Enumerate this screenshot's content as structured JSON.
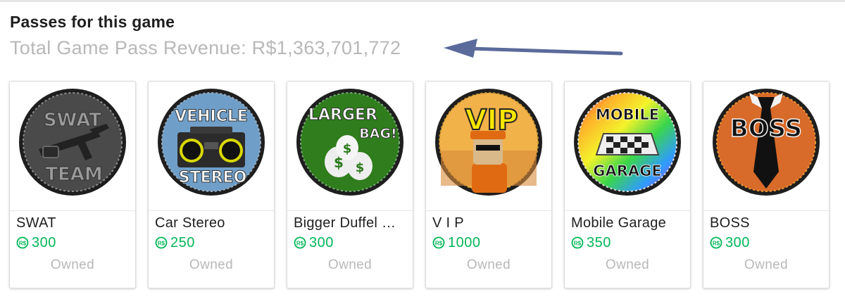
{
  "section": {
    "title": "Passes for this game",
    "revenue": "Total Game Pass Revenue: R$1,363,701,772"
  },
  "accent_colors": {
    "price_green": "#02b757",
    "muted_gray": "#b8b8b8",
    "arrow_blue": "#5a6a9a"
  },
  "passes": [
    {
      "name": "SWAT",
      "price": "300",
      "status": "Owned",
      "icon": "swat-team-badge-icon",
      "badge_lines": [
        "SWAT",
        "TEAM"
      ]
    },
    {
      "name": "Car Stereo",
      "price": "250",
      "status": "Owned",
      "icon": "boombox-stereo-badge-icon",
      "badge_lines": [
        "VEHICLE",
        "STEREO"
      ]
    },
    {
      "name": "Bigger Duffel …",
      "price": "300",
      "status": "Owned",
      "icon": "money-bags-badge-icon",
      "badge_lines": [
        "LARGER",
        "BAG!"
      ]
    },
    {
      "name": "V I P",
      "price": "1000",
      "status": "Owned",
      "icon": "vip-character-badge-icon",
      "badge_lines": [
        "VIP"
      ]
    },
    {
      "name": "Mobile Garage",
      "price": "350",
      "status": "Owned",
      "icon": "mobile-garage-badge-icon",
      "badge_lines": [
        "MOBILE",
        "GARAGE"
      ]
    },
    {
      "name": "BOSS",
      "price": "300",
      "status": "Owned",
      "icon": "boss-tie-badge-icon",
      "badge_lines": [
        "BOSS"
      ]
    }
  ]
}
